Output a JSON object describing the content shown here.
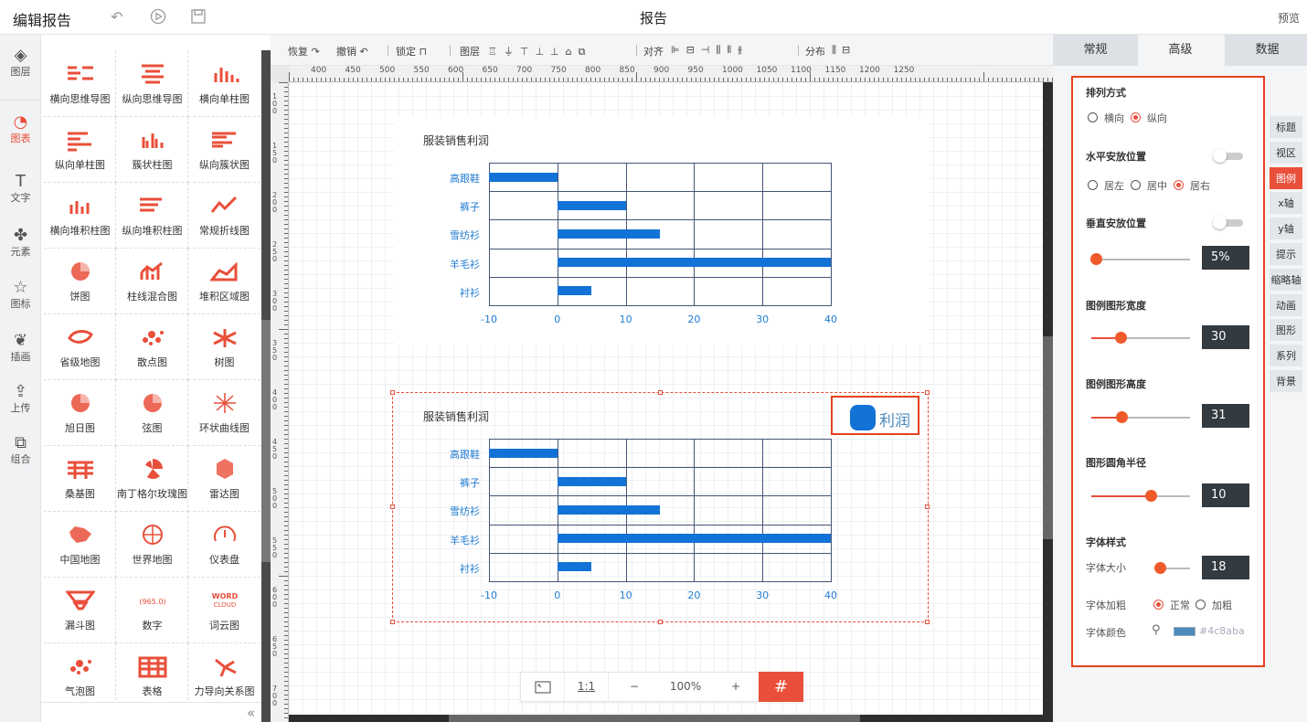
{
  "header": {
    "app_title": "编辑报告",
    "report_title": "报告",
    "preview_label": "预览"
  },
  "rail": [
    {
      "label": "图层",
      "icon": "layers-icon",
      "glyph": "◈"
    },
    {
      "label": "图表",
      "icon": "chart-icon",
      "glyph": "◔"
    },
    {
      "label": "文字",
      "icon": "text-icon",
      "glyph": "T"
    },
    {
      "label": "元素",
      "icon": "elements-icon",
      "glyph": "✤"
    },
    {
      "label": "图标",
      "icon": "star-icon",
      "glyph": "☆"
    },
    {
      "label": "插画",
      "icon": "illustration-icon",
      "glyph": "❦"
    },
    {
      "label": "上传",
      "icon": "upload-icon",
      "glyph": "⇪"
    },
    {
      "label": "组合",
      "icon": "group-icon",
      "glyph": "⧉"
    }
  ],
  "components": [
    "横向思维导图",
    "纵向思维导图",
    "横向单柱图",
    "纵向单柱图",
    "簇状柱图",
    "纵向簇状图",
    "横向堆积柱图",
    "纵向堆积柱图",
    "常规折线图",
    "饼图",
    "柱线混合图",
    "堆积区域图",
    "省级地图",
    "散点图",
    "树图",
    "旭日图",
    "弦图",
    "环状曲线图",
    "桑基图",
    "南丁格尔玫瑰图",
    "雷达图",
    "中国地图",
    "世界地图",
    "仪表盘",
    "漏斗图",
    "数字",
    "词云图",
    "气泡图",
    "表格",
    "力导向关系图"
  ],
  "component_icon_texts": {
    "number": "(965.0)",
    "wordcloud": "WORD CLOUD"
  },
  "toolbar": {
    "redo": "恢复",
    "undo": "撤销",
    "lock": "锁定",
    "layer": "图层",
    "align": "对齐",
    "distribute": "分布"
  },
  "ruler_top": [
    "400",
    "450",
    "500",
    "550",
    "600",
    "650",
    "700",
    "750",
    "800",
    "850",
    "900",
    "950",
    "1000",
    "1050",
    "1100",
    "1150",
    "1200",
    "1250"
  ],
  "ruler_left": [
    "100",
    "150",
    "200",
    "250",
    "300",
    "350",
    "400",
    "450",
    "500",
    "550",
    "600",
    "650",
    "700"
  ],
  "charts": [
    {
      "title": "服装销售利润"
    },
    {
      "title": "服装销售利润"
    }
  ],
  "chart_data": [
    {
      "type": "bar",
      "orientation": "horizontal",
      "title": "服装销售利润",
      "categories": [
        "高跟鞋",
        "裤子",
        "雪纺衫",
        "羊毛衫",
        "衬衫"
      ],
      "series": [
        {
          "values": [
            -10,
            10,
            15,
            40,
            5
          ]
        }
      ],
      "xlim": [
        -10,
        40
      ],
      "x_ticks": [
        "-10",
        "0",
        "10",
        "20",
        "30",
        "40"
      ],
      "grid": true
    },
    {
      "type": "bar",
      "orientation": "horizontal",
      "title": "服装销售利润",
      "categories": [
        "高跟鞋",
        "裤子",
        "雪纺衫",
        "羊毛衫",
        "衬衫"
      ],
      "series": [
        {
          "name": "利润",
          "values": [
            -10,
            10,
            15,
            40,
            5
          ]
        }
      ],
      "xlim": [
        -10,
        40
      ],
      "x_ticks": [
        "-10",
        "0",
        "10",
        "20",
        "30",
        "40"
      ],
      "grid": true,
      "legend": "top-right"
    }
  ],
  "zoom": {
    "fit_label": "",
    "one_to_one": "1:1",
    "minus": "−",
    "value": "100%",
    "plus": "+"
  },
  "right_panel": {
    "tabs": [
      "常规",
      "高级",
      "数据"
    ],
    "active_tab": "高级",
    "side_tabs": [
      "标题",
      "视区",
      "图例",
      "x轴",
      "y轴",
      "提示",
      "缩略轴",
      "动画",
      "图形",
      "系列",
      "背景"
    ],
    "active_side_tab": "图例",
    "layout": {
      "label": "排列方式",
      "options": [
        "横向",
        "纵向"
      ],
      "selected": "纵向"
    },
    "h_pos": {
      "label": "水平安放位置",
      "toggle": false,
      "options": [
        "居左",
        "居中",
        "居右"
      ],
      "selected": "居右"
    },
    "v_pos": {
      "label": "垂直安放位置",
      "toggle": false,
      "value": "5%",
      "level": 0.05
    },
    "legend_width": {
      "label": "图例图形宽度",
      "value": "30",
      "level": 0.3
    },
    "legend_height": {
      "label": "图例图形高度",
      "value": "31",
      "level": 0.31
    },
    "radius": {
      "label": "图形圆角半径",
      "value": "10",
      "level": 0.6
    },
    "font": {
      "label": "字体样式",
      "size_label": "字体大小",
      "size_value": "18",
      "size_level": 0.02,
      "weight_label": "字体加粗",
      "weight_options": [
        "正常",
        "加粗"
      ],
      "weight_selected": "正常",
      "color_label": "字体颜色",
      "color_value": "#4c8aba"
    }
  },
  "colors": {
    "accent": "#e94f3a",
    "bar": "#1372d6",
    "legend_text": "#4c8aba"
  }
}
